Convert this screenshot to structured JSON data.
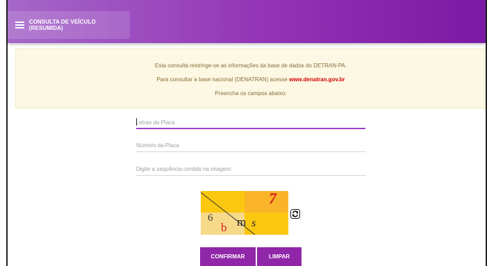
{
  "header": {
    "menu_label": "CONSULTA DE VEÍCULO (RESUMIDA)",
    "menu_icon": "hamburger-menu-icon",
    "colors": {
      "start": "#a567c9",
      "end": "#7a1aa3"
    }
  },
  "notice": {
    "line1": "Esta consulta restringe-se as informações da base de dados do DETRAN-PA.",
    "line2_prefix": "Para consultar a base nacional (DENATRAN) acesse ",
    "line2_link": "www.denatran.gov.br",
    "line3": "Preencha os campos abaixo:",
    "link_color": "#d50000"
  },
  "form": {
    "plate_letters": {
      "placeholder": "Letras da Placa",
      "value": ""
    },
    "plate_number": {
      "placeholder": "Número da Placa",
      "value": ""
    },
    "captcha_input": {
      "placeholder": "Digite a sequência contida na imagem:",
      "value": ""
    }
  },
  "captcha": {
    "chars": {
      "c1": "7",
      "c2": "6",
      "c3": "b",
      "c4": "m",
      "c5": "s"
    },
    "refresh_icon": "refresh-icon"
  },
  "buttons": {
    "confirm": "CONFIRMAR",
    "clear": "LIMPAR",
    "color": "#9026a8"
  }
}
